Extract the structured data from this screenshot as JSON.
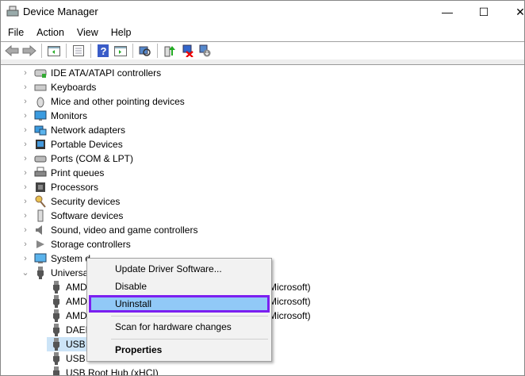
{
  "window": {
    "title": "Device Manager",
    "controls": [
      "minimize",
      "maximize",
      "close"
    ]
  },
  "menu": [
    "File",
    "Action",
    "View",
    "Help"
  ],
  "toolbar": [
    "back-icon",
    "forward-icon",
    "show-hide-console-tree-icon",
    "properties-icon",
    "help-icon",
    "show-action-pane-icon",
    "scan-hardware-icon",
    "update-driver-icon",
    "uninstall-device-icon",
    "disable-device-icon"
  ],
  "tree": {
    "categories": [
      {
        "label": "IDE ATA/ATAPI controllers",
        "icon": "ide-icon"
      },
      {
        "label": "Keyboards",
        "icon": "keyboard-icon"
      },
      {
        "label": "Mice and other pointing devices",
        "icon": "mouse-icon"
      },
      {
        "label": "Monitors",
        "icon": "monitor-icon"
      },
      {
        "label": "Network adapters",
        "icon": "network-icon"
      },
      {
        "label": "Portable Devices",
        "icon": "portable-device-icon"
      },
      {
        "label": "Ports (COM & LPT)",
        "icon": "port-icon"
      },
      {
        "label": "Print queues",
        "icon": "printer-icon"
      },
      {
        "label": "Processors",
        "icon": "processor-icon"
      },
      {
        "label": "Security devices",
        "icon": "key-icon"
      },
      {
        "label": "Software devices",
        "icon": "software-device-icon"
      },
      {
        "label": "Sound, video and game controllers",
        "icon": "speaker-icon"
      },
      {
        "label": "Storage controllers",
        "icon": "storage-icon"
      },
      {
        "label": "System d",
        "icon": "computer-icon"
      },
      {
        "label": "Universa",
        "icon": "usb-icon",
        "expanded": true
      }
    ],
    "children": [
      {
        "label": "AMD",
        "suffix": "Microsoft)"
      },
      {
        "label": "AMD",
        "suffix": "Microsoft)"
      },
      {
        "label": "AMD",
        "suffix": "Microsoft)"
      },
      {
        "label": "DAEM",
        "suffix": ""
      },
      {
        "label": "USB I",
        "suffix": "",
        "selected": true
      },
      {
        "label": "USB I",
        "suffix": ""
      },
      {
        "label": "USB Root Hub (xHCI)",
        "suffix": ""
      }
    ]
  },
  "context_menu": {
    "items": [
      {
        "label": "Update Driver Software..."
      },
      {
        "label": "Disable"
      },
      {
        "label": "Uninstall",
        "highlighted": true
      },
      {
        "label": "Scan for hardware changes"
      },
      {
        "label": "Properties",
        "bold": true
      }
    ],
    "highlight_color": "#91c9f7",
    "outline_color": "#7b1ff0"
  }
}
